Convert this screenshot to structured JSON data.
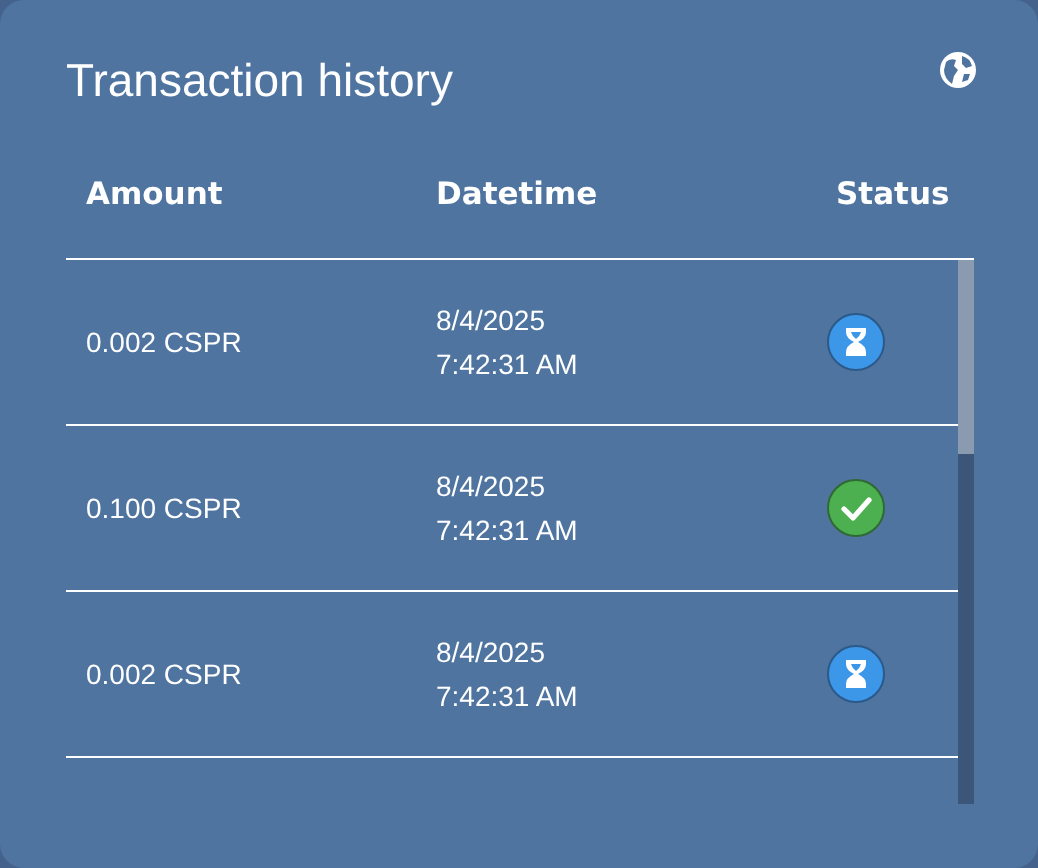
{
  "title": "Transaction history",
  "columns": [
    "Amount",
    "Datetime",
    "Status"
  ],
  "rows": [
    {
      "amount": "0.002 CSPR",
      "date": "8/4/2025",
      "time": "7:42:31 AM",
      "kind": "pending"
    },
    {
      "amount": "0.100 CSPR",
      "date": "8/4/2025",
      "time": "7:42:31 AM",
      "kind": "success"
    },
    {
      "amount": "0.002 CSPR",
      "date": "8/4/2025",
      "time": "7:42:31 AM",
      "kind": "pending"
    }
  ]
}
